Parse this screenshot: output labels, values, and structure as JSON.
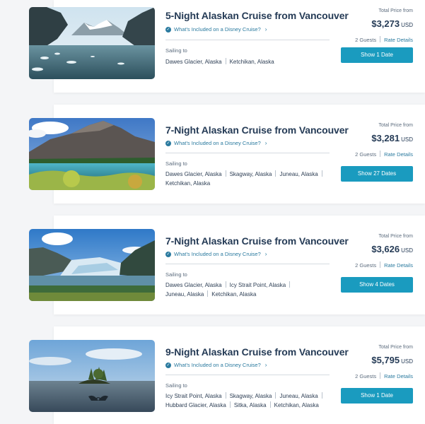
{
  "cruises": [
    {
      "title": "5-Night Alaskan Cruise from Vancouver",
      "included_link": "What's Included on a Disney Cruise?",
      "sailing_label": "Sailing to",
      "ports": [
        "Dawes Glacier, Alaska",
        "Ketchikan, Alaska"
      ],
      "total_label": "Total Price from",
      "price": "$3,273",
      "currency": "USD",
      "guests": "2 Guests",
      "rate_details": "Rate Details",
      "button": "Show 1 Date",
      "image": "fjord-icebergs-photo"
    },
    {
      "title": "7-Night Alaskan Cruise from Vancouver",
      "included_link": "What's Included on a Disney Cruise?",
      "sailing_label": "Sailing to",
      "ports": [
        "Dawes Glacier, Alaska",
        "Skagway, Alaska",
        "Juneau, Alaska",
        "Ketchikan, Alaska"
      ],
      "total_label": "Total Price from",
      "price": "$3,281",
      "currency": "USD",
      "guests": "2 Guests",
      "rate_details": "Rate Details",
      "button": "Show 27 Dates",
      "image": "mountain-lake-photo"
    },
    {
      "title": "7-Night Alaskan Cruise from Vancouver",
      "included_link": "What's Included on a Disney Cruise?",
      "sailing_label": "Sailing to",
      "ports": [
        "Dawes Glacier, Alaska",
        "Icy Strait Point, Alaska",
        "Juneau, Alaska",
        "Ketchikan, Alaska"
      ],
      "total_label": "Total Price from",
      "price": "$3,626",
      "currency": "USD",
      "guests": "2 Guests",
      "rate_details": "Rate Details",
      "button": "Show 4 Dates",
      "image": "glacier-photo"
    },
    {
      "title": "9-Night Alaskan Cruise from Vancouver",
      "included_link": "What's Included on a Disney Cruise?",
      "sailing_label": "Sailing to",
      "ports": [
        "Icy Strait Point, Alaska",
        "Skagway, Alaska",
        "Juneau, Alaska",
        "Hubbard Glacier, Alaska",
        "Sitka, Alaska",
        "Ketchikan, Alaska"
      ],
      "total_label": "Total Price from",
      "price": "$5,795",
      "currency": "USD",
      "guests": "2 Guests",
      "rate_details": "Rate Details",
      "button": "Show 1 Date",
      "image": "whale-tail-island-photo"
    }
  ],
  "colors": {
    "title": "#253b56",
    "link": "#2a7a9f",
    "button": "#1a9bbf",
    "background": "#f4f5f7"
  }
}
